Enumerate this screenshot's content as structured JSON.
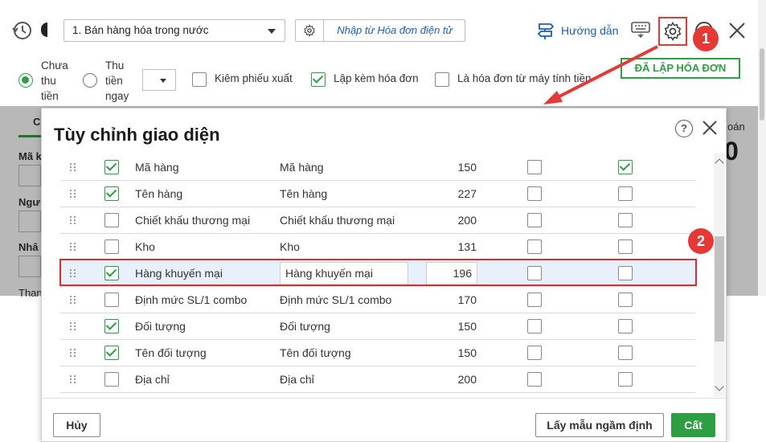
{
  "toolbar": {
    "sale_type": "1. Bán hàng hóa trong nước",
    "import_label": "Nhập từ Hóa đơn điện tử",
    "guide_label": "Hướng dẫn"
  },
  "options": {
    "radio_unpaid": "Chưa\nthu\ntiền",
    "radio_paid": "Thu\ntiền\nngay",
    "check_warehouse": "Kiêm phiếu xuất",
    "check_invoice": "Lập kèm hóa đơn",
    "check_pos": "Là hóa đơn từ máy tính tiền",
    "done_label": "ĐÃ LẬP HÓA ĐƠN"
  },
  "left_fields": [
    "C",
    "Mã k",
    "Ngư",
    "Nhâ",
    "Than"
  ],
  "right_text": "oán",
  "right_big": "0",
  "dialog": {
    "title": "Tùy chỉnh giao diện",
    "rows": [
      {
        "checked": true,
        "name": "Mã hàng",
        "caption": "Mã hàng",
        "width": "150",
        "c4": false,
        "c5": true
      },
      {
        "checked": true,
        "name": "Tên hàng",
        "caption": "Tên hàng",
        "width": "227",
        "c4": false,
        "c5": false
      },
      {
        "checked": false,
        "name": "Chiết khấu thương mại",
        "caption": "Chiết khấu thương mại",
        "width": "200",
        "c4": false,
        "c5": false
      },
      {
        "checked": false,
        "name": "Kho",
        "caption": "Kho",
        "width": "131",
        "c4": false,
        "c5": false
      },
      {
        "checked": true,
        "name": "Hàng khuyến mại",
        "caption": "Hàng khuyến mại",
        "width": "196",
        "c4": false,
        "c5": false
      },
      {
        "checked": false,
        "name": "Định mức SL/1 combo",
        "caption": "Định mức SL/1 combo",
        "width": "170",
        "c4": false,
        "c5": false
      },
      {
        "checked": true,
        "name": "Đối tượng",
        "caption": "Đối tượng",
        "width": "150",
        "c4": false,
        "c5": false
      },
      {
        "checked": true,
        "name": "Tên đối tượng",
        "caption": "Tên đối tượng",
        "width": "150",
        "c4": false,
        "c5": false
      },
      {
        "checked": false,
        "name": "Địa chỉ",
        "caption": "Địa chỉ",
        "width": "200",
        "c4": false,
        "c5": false
      }
    ],
    "cancel_label": "Hủy",
    "default_label": "Lấy mẫu ngầm định",
    "save_label": "Cất"
  },
  "annotations": {
    "step1": "1",
    "step2": "2",
    "color": "#e53935"
  },
  "colors": {
    "accent_green": "#2e9e44",
    "link_blue": "#1a5fb4",
    "highlight_row": "#e8f1fb"
  }
}
